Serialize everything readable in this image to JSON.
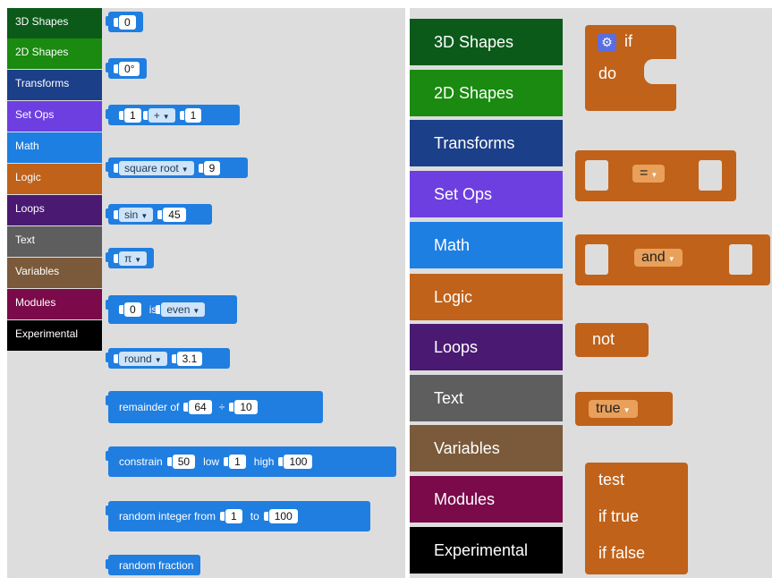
{
  "categories": [
    {
      "label": "3D Shapes",
      "color": "#0b5a1a"
    },
    {
      "label": "2D Shapes",
      "color": "#1a8a10"
    },
    {
      "label": "Transforms",
      "color": "#1b3f88"
    },
    {
      "label": "Set Ops",
      "color": "#6e3fe0"
    },
    {
      "label": "Math",
      "color": "#1e7fe2"
    },
    {
      "label": "Logic",
      "color": "#c0621a"
    },
    {
      "label": "Loops",
      "color": "#4a1a72"
    },
    {
      "label": "Text",
      "color": "#5e5e5e"
    },
    {
      "label": "Variables",
      "color": "#7a5a3a"
    },
    {
      "label": "Modules",
      "color": "#7a0a4a"
    },
    {
      "label": "Experimental",
      "color": "#000000"
    }
  ],
  "math_blocks": {
    "num": "0",
    "deg": "0°",
    "arith": {
      "a": "1",
      "op": "+",
      "b": "1"
    },
    "sqrt": {
      "fn": "square root",
      "val": "9"
    },
    "trig": {
      "fn": "sin",
      "val": "45"
    },
    "const": "π",
    "even": {
      "val": "0",
      "is": "is",
      "prop": "even"
    },
    "round": {
      "fn": "round",
      "val": "3.1"
    },
    "rem": {
      "label": "remainder of",
      "a": "64",
      "op": "÷",
      "b": "10"
    },
    "constrain": {
      "label": "constrain",
      "val": "50",
      "low_label": "low",
      "low": "1",
      "high_label": "high",
      "high": "100"
    },
    "randint": {
      "label": "random integer from",
      "from": "1",
      "to_label": "to",
      "to": "100"
    },
    "randfrac": "random fraction"
  },
  "logic_blocks": {
    "if": "if",
    "do": "do",
    "compare_op": "=",
    "and_op": "and",
    "not": "not",
    "bool": "true",
    "test": "test",
    "if_true": "if true",
    "if_false": "if false"
  }
}
